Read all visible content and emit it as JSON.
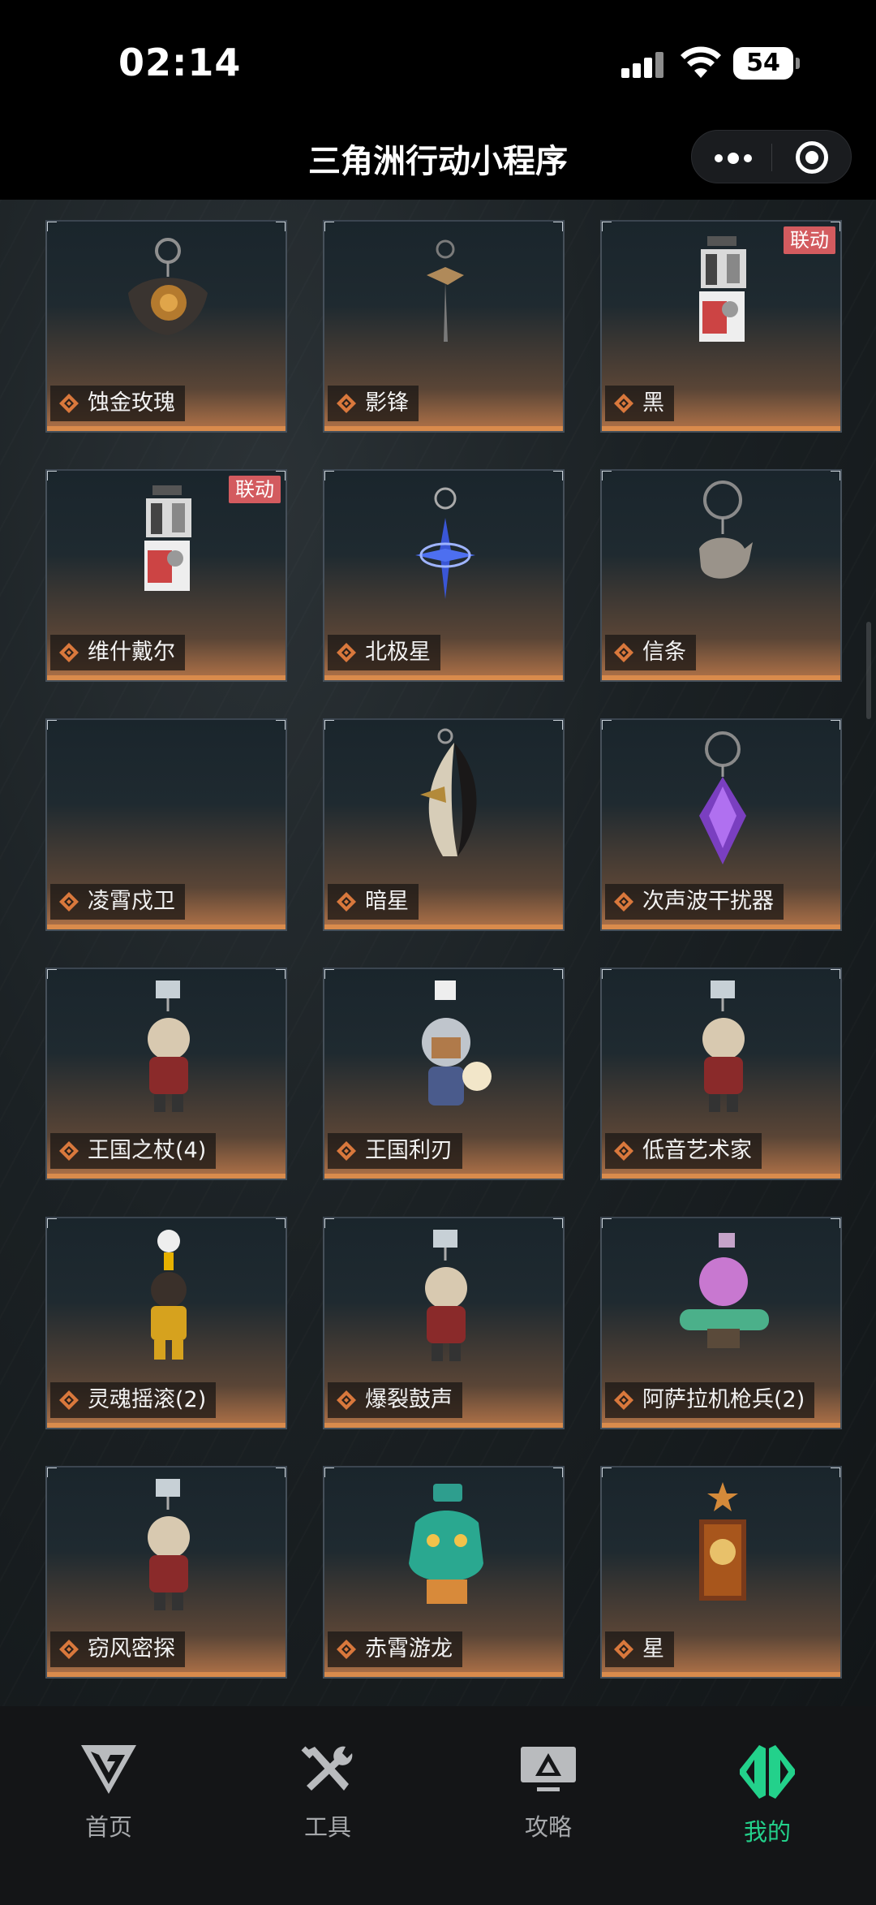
{
  "status_bar": {
    "time": "02:14",
    "battery": "54"
  },
  "nav": {
    "title": "三角洲行动小程序"
  },
  "items": [
    {
      "name": "蚀金玫瑰",
      "badge": "",
      "charm": "rose-charm-icon"
    },
    {
      "name": "影锋",
      "badge": "",
      "charm": "blade-charm-icon"
    },
    {
      "name": "黑",
      "badge": "联动",
      "charm": "card-charm-icon"
    },
    {
      "name": "维什戴尔",
      "badge": "联动",
      "charm": "card-charm-icon"
    },
    {
      "name": "北极星",
      "badge": "",
      "charm": "star-charm-icon"
    },
    {
      "name": "信条",
      "badge": "",
      "charm": "teapot-charm-icon"
    },
    {
      "name": "凌霄戍卫",
      "badge": "",
      "charm": ""
    },
    {
      "name": "暗星",
      "badge": "",
      "charm": "mask-charm-icon"
    },
    {
      "name": "次声波干扰器",
      "badge": "",
      "charm": "crystal-charm-icon"
    },
    {
      "name": "王国之杖(4)",
      "badge": "",
      "charm": "figure-charm-icon"
    },
    {
      "name": "王国利刃",
      "badge": "",
      "charm": "knight-charm-icon"
    },
    {
      "name": "低音艺术家",
      "badge": "",
      "charm": "figure-charm-icon"
    },
    {
      "name": "灵魂摇滚(2)",
      "badge": "",
      "charm": "rocker-charm-icon"
    },
    {
      "name": "爆裂鼓声",
      "badge": "",
      "charm": "figure-charm-icon"
    },
    {
      "name": "阿萨拉机枪兵(2)",
      "badge": "",
      "charm": "gunner-charm-icon"
    },
    {
      "name": "窃风密探",
      "badge": "",
      "charm": "figure-charm-icon"
    },
    {
      "name": "赤霄游龙",
      "badge": "",
      "charm": "dragon-charm-icon"
    },
    {
      "name": "星",
      "badge": "",
      "charm": "tarot-charm-icon"
    }
  ],
  "tabs": [
    {
      "label": "首页",
      "icon": "home-logo-icon",
      "active": false
    },
    {
      "label": "工具",
      "icon": "tools-icon",
      "active": false
    },
    {
      "label": "攻略",
      "icon": "guide-monitor-icon",
      "active": false
    },
    {
      "label": "我的",
      "icon": "profile-logo-icon",
      "active": true
    }
  ],
  "colors": {
    "active_tab": "#23d18b",
    "badge": "#d35b5f",
    "card_bottom": "#d98b4c"
  }
}
